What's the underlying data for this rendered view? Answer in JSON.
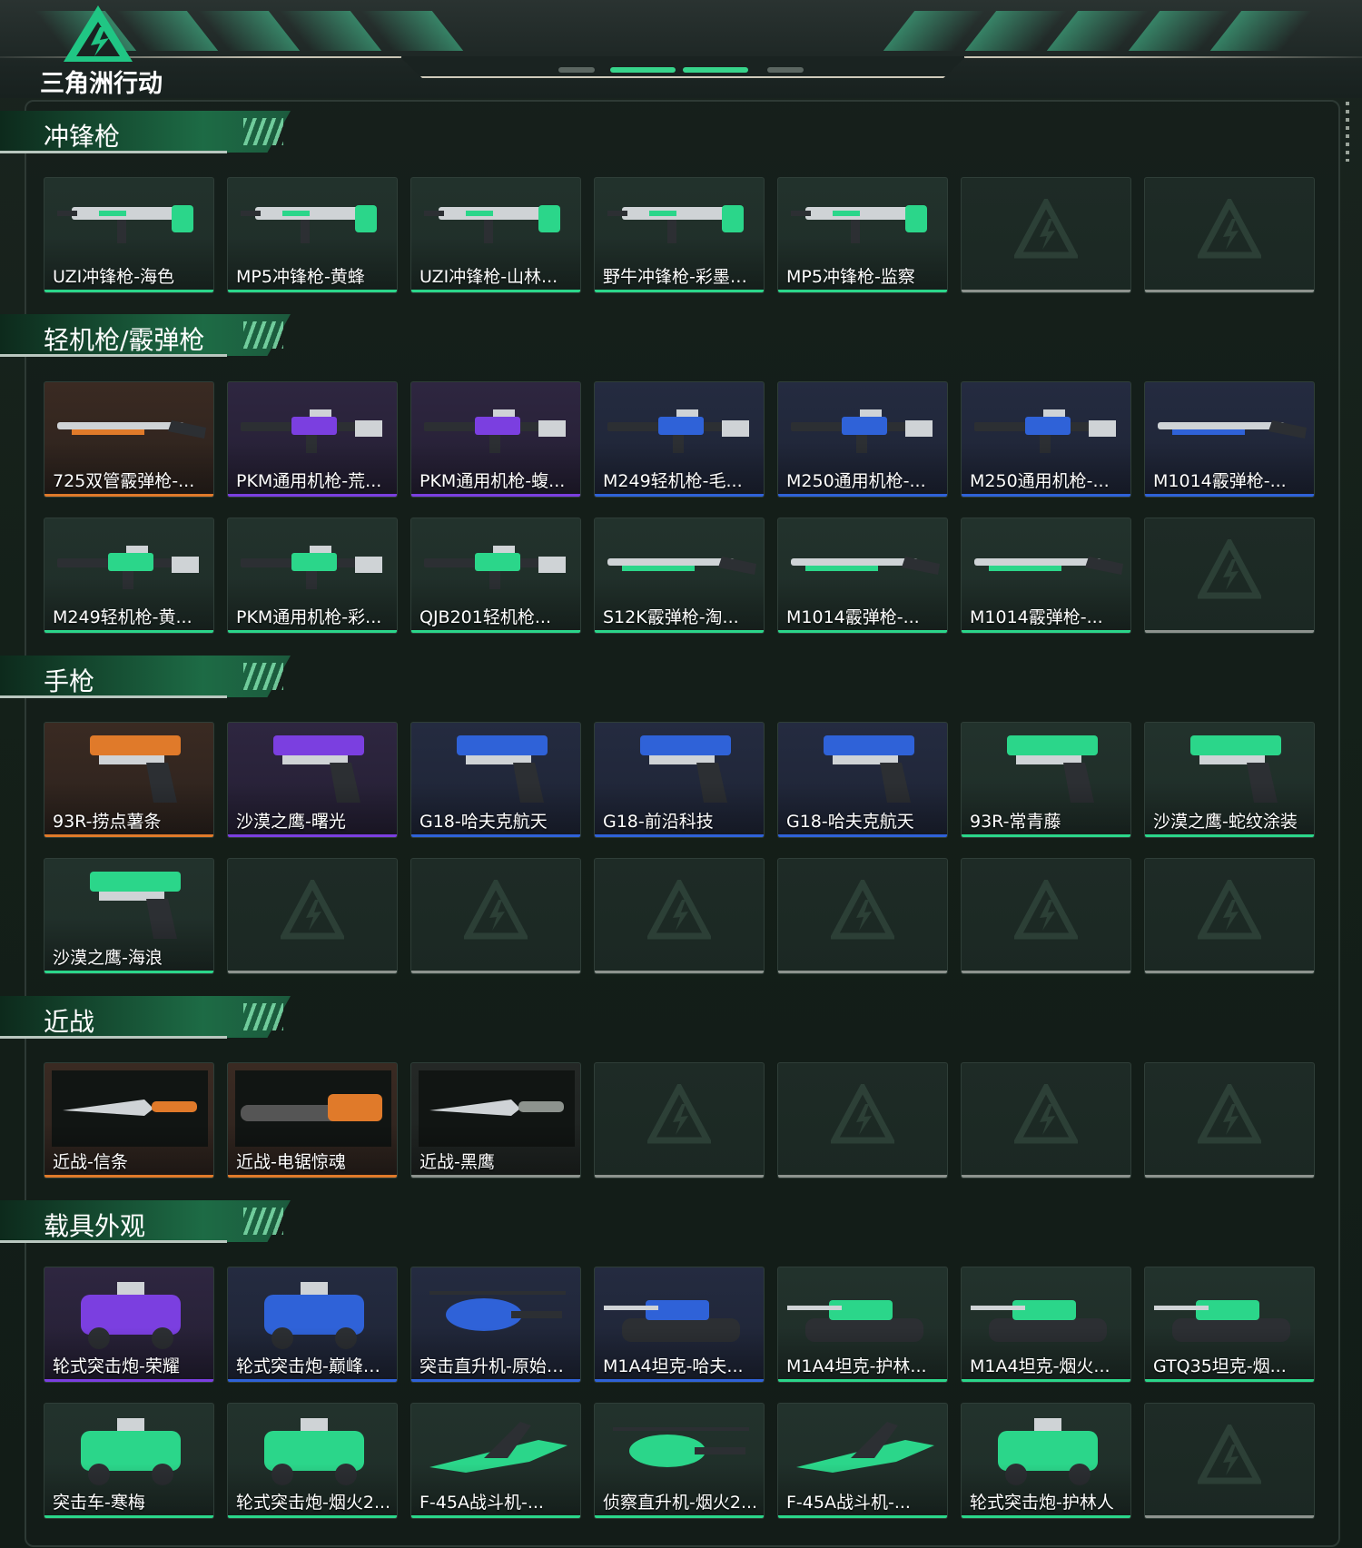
{
  "header": {
    "logo_text": "三角洲行动",
    "logo_icon": "delta-triangle-logo"
  },
  "colors": {
    "green": "#2bd68a",
    "orange": "#e07a2a",
    "purple": "#7b3fe0",
    "blue": "#2f62d8",
    "gray": "#8d938e"
  },
  "sections": [
    {
      "title": "冲锋枪",
      "items": [
        {
          "name": "UZI冲锋枪-海色",
          "rarity": "green",
          "icon": "smg-icon"
        },
        {
          "name": "MP5冲锋枪-黄蜂",
          "rarity": "green",
          "icon": "smg-icon"
        },
        {
          "name": "UZI冲锋枪-山林...",
          "rarity": "green",
          "icon": "smg-icon"
        },
        {
          "name": "野牛冲锋枪-彩墨喷...",
          "rarity": "green",
          "icon": "smg-icon"
        },
        {
          "name": "MP5冲锋枪-监察",
          "rarity": "green",
          "icon": "smg-icon"
        },
        {
          "name": "",
          "rarity": "empty"
        },
        {
          "name": "",
          "rarity": "empty"
        }
      ]
    },
    {
      "title": "轻机枪/霰弹枪",
      "items": [
        {
          "name": "725双管霰弹枪-...",
          "rarity": "orange",
          "icon": "shotgun-icon"
        },
        {
          "name": "PKM通用机枪-荒...",
          "rarity": "purple",
          "icon": "lmg-icon"
        },
        {
          "name": "PKM通用机枪-蝮...",
          "rarity": "purple",
          "icon": "lmg-icon"
        },
        {
          "name": "M249轻机枪-毛...",
          "rarity": "blue",
          "icon": "lmg-icon"
        },
        {
          "name": "M250通用机枪-...",
          "rarity": "blue",
          "icon": "lmg-icon"
        },
        {
          "name": "M250通用机枪-...",
          "rarity": "blue",
          "icon": "lmg-icon"
        },
        {
          "name": "M1014霰弹枪-...",
          "rarity": "blue",
          "icon": "shotgun-icon"
        },
        {
          "name": "M249轻机枪-黄...",
          "rarity": "green",
          "icon": "lmg-icon"
        },
        {
          "name": "PKM通用机枪-彩...",
          "rarity": "green",
          "icon": "lmg-icon"
        },
        {
          "name": "QJB201轻机枪...",
          "rarity": "green",
          "icon": "lmg-icon"
        },
        {
          "name": "S12K霰弹枪-淘...",
          "rarity": "green",
          "icon": "shotgun-icon"
        },
        {
          "name": "M1014霰弹枪-...",
          "rarity": "green",
          "icon": "shotgun-icon"
        },
        {
          "name": "M1014霰弹枪-...",
          "rarity": "green",
          "icon": "shotgun-icon"
        },
        {
          "name": "",
          "rarity": "empty"
        }
      ]
    },
    {
      "title": "手枪",
      "items": [
        {
          "name": "93R-捞点薯条",
          "rarity": "orange",
          "icon": "pistol-icon"
        },
        {
          "name": "沙漠之鹰-曙光",
          "rarity": "purple",
          "icon": "pistol-icon"
        },
        {
          "name": "G18-哈夫克航天",
          "rarity": "blue",
          "icon": "pistol-icon"
        },
        {
          "name": "G18-前沿科技",
          "rarity": "blue",
          "icon": "pistol-icon"
        },
        {
          "name": "G18-哈夫克航天",
          "rarity": "blue",
          "icon": "pistol-icon"
        },
        {
          "name": "93R-常青藤",
          "rarity": "green",
          "icon": "pistol-icon"
        },
        {
          "name": "沙漠之鹰-蛇纹涂装",
          "rarity": "green",
          "icon": "pistol-icon"
        },
        {
          "name": "沙漠之鹰-海浪",
          "rarity": "green",
          "icon": "pistol-icon"
        },
        {
          "name": "",
          "rarity": "empty"
        },
        {
          "name": "",
          "rarity": "empty"
        },
        {
          "name": "",
          "rarity": "empty"
        },
        {
          "name": "",
          "rarity": "empty"
        },
        {
          "name": "",
          "rarity": "empty"
        },
        {
          "name": "",
          "rarity": "empty"
        }
      ]
    },
    {
      "title": "近战",
      "items": [
        {
          "name": "近战-信条",
          "rarity": "orange",
          "icon": "knife-icon"
        },
        {
          "name": "近战-电锯惊魂",
          "rarity": "orange",
          "icon": "chainsaw-icon"
        },
        {
          "name": "近战-黑鹰",
          "rarity": "gray",
          "icon": "knife-icon"
        },
        {
          "name": "",
          "rarity": "empty"
        },
        {
          "name": "",
          "rarity": "empty"
        },
        {
          "name": "",
          "rarity": "empty"
        },
        {
          "name": "",
          "rarity": "empty"
        }
      ]
    },
    {
      "title": "载具外观",
      "items": [
        {
          "name": "轮式突击炮-荣耀",
          "rarity": "purple",
          "icon": "armored-car-icon"
        },
        {
          "name": "轮式突击炮-巅峰竞...",
          "rarity": "blue",
          "icon": "armored-car-icon"
        },
        {
          "name": "突击直升机-原始伪...",
          "rarity": "blue",
          "icon": "helicopter-icon"
        },
        {
          "name": "M1A4坦克-哈夫...",
          "rarity": "blue",
          "icon": "tank-icon"
        },
        {
          "name": "M1A4坦克-护林...",
          "rarity": "green",
          "icon": "tank-icon"
        },
        {
          "name": "M1A4坦克-烟火...",
          "rarity": "green",
          "icon": "tank-icon"
        },
        {
          "name": "GTQ35坦克-烟...",
          "rarity": "green",
          "icon": "tank-icon"
        },
        {
          "name": "突击车-寒梅",
          "rarity": "green",
          "icon": "armored-car-icon"
        },
        {
          "name": "轮式突击炮-烟火2...",
          "rarity": "green",
          "icon": "armored-car-icon"
        },
        {
          "name": "F-45A战斗机-...",
          "rarity": "green",
          "icon": "jet-icon"
        },
        {
          "name": "侦察直升机-烟火2...",
          "rarity": "green",
          "icon": "helicopter-icon"
        },
        {
          "name": "F-45A战斗机-...",
          "rarity": "green",
          "icon": "jet-icon"
        },
        {
          "name": "轮式突击炮-护林人",
          "rarity": "green",
          "icon": "armored-car-icon"
        },
        {
          "name": "",
          "rarity": "empty"
        }
      ]
    }
  ]
}
